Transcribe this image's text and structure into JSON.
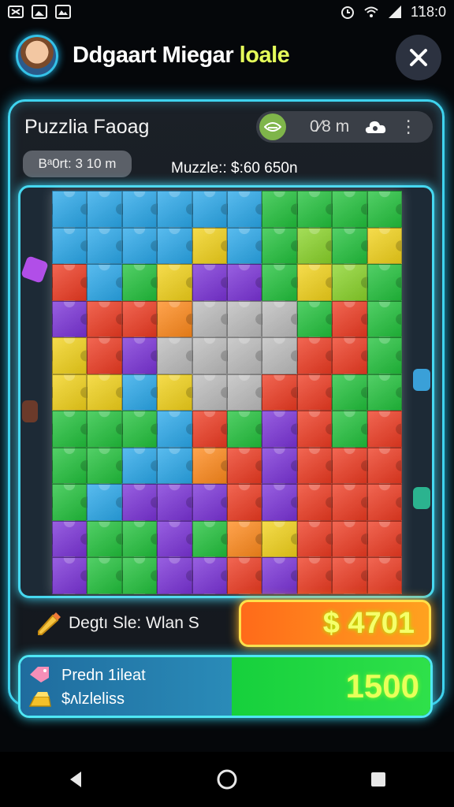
{
  "status_bar": {
    "time": "1̃18:0",
    "left_icons": [
      "screen-share-icon",
      "image-icon",
      "gallery-icon"
    ],
    "right_icons": [
      "alarm-icon",
      "wifi-icon",
      "signal-icon"
    ]
  },
  "header": {
    "title_main": "Ddgaart Miegar ",
    "title_accent": "loale",
    "close_icon": "close-icon"
  },
  "panel": {
    "title": "Puzzlia Faoag",
    "toolbar": {
      "text": "0⁄8 m",
      "icons": [
        "eye-icon",
        "cloud-icon",
        "more-icon"
      ]
    },
    "timer": "Bᵃ0rt: 3 10 m",
    "puzzle_info": "Muzzle:: $:60 650n"
  },
  "board": {
    "rows": 11,
    "cols": 10,
    "colors": {
      "b": "#2aa8ea",
      "g": "#22c23c",
      "y": "#f2d21a",
      "r": "#ee3b22",
      "p": "#7b33d8",
      "o": "#ff8a1c",
      "s": "#bdbdbd",
      "l": "#8ad42a"
    },
    "tiles": [
      "bbbbbbgggg",
      "bbbbybglgy",
      "rbgyppgylg",
      "prrosssgrg",
      "yrpssssrrg",
      "yybyssrrgg",
      "gggbrgprgr",
      "ggbborprrr",
      "gbppprprrr",
      "pggpgoyrrr",
      "pggpprprrr"
    ]
  },
  "stats": {
    "label": "Degtı Sle: Wlan S",
    "price": "$ 4701",
    "pencil_icon": "pencil-icon"
  },
  "promo": {
    "line1": "Predn 1ileat",
    "line2": "$ʌlzleliss",
    "value": "1500",
    "icons": [
      "tag-icon",
      "gold-bar-icon"
    ]
  },
  "nav": {
    "icons": [
      "back-icon",
      "home-icon",
      "recents-icon"
    ]
  }
}
